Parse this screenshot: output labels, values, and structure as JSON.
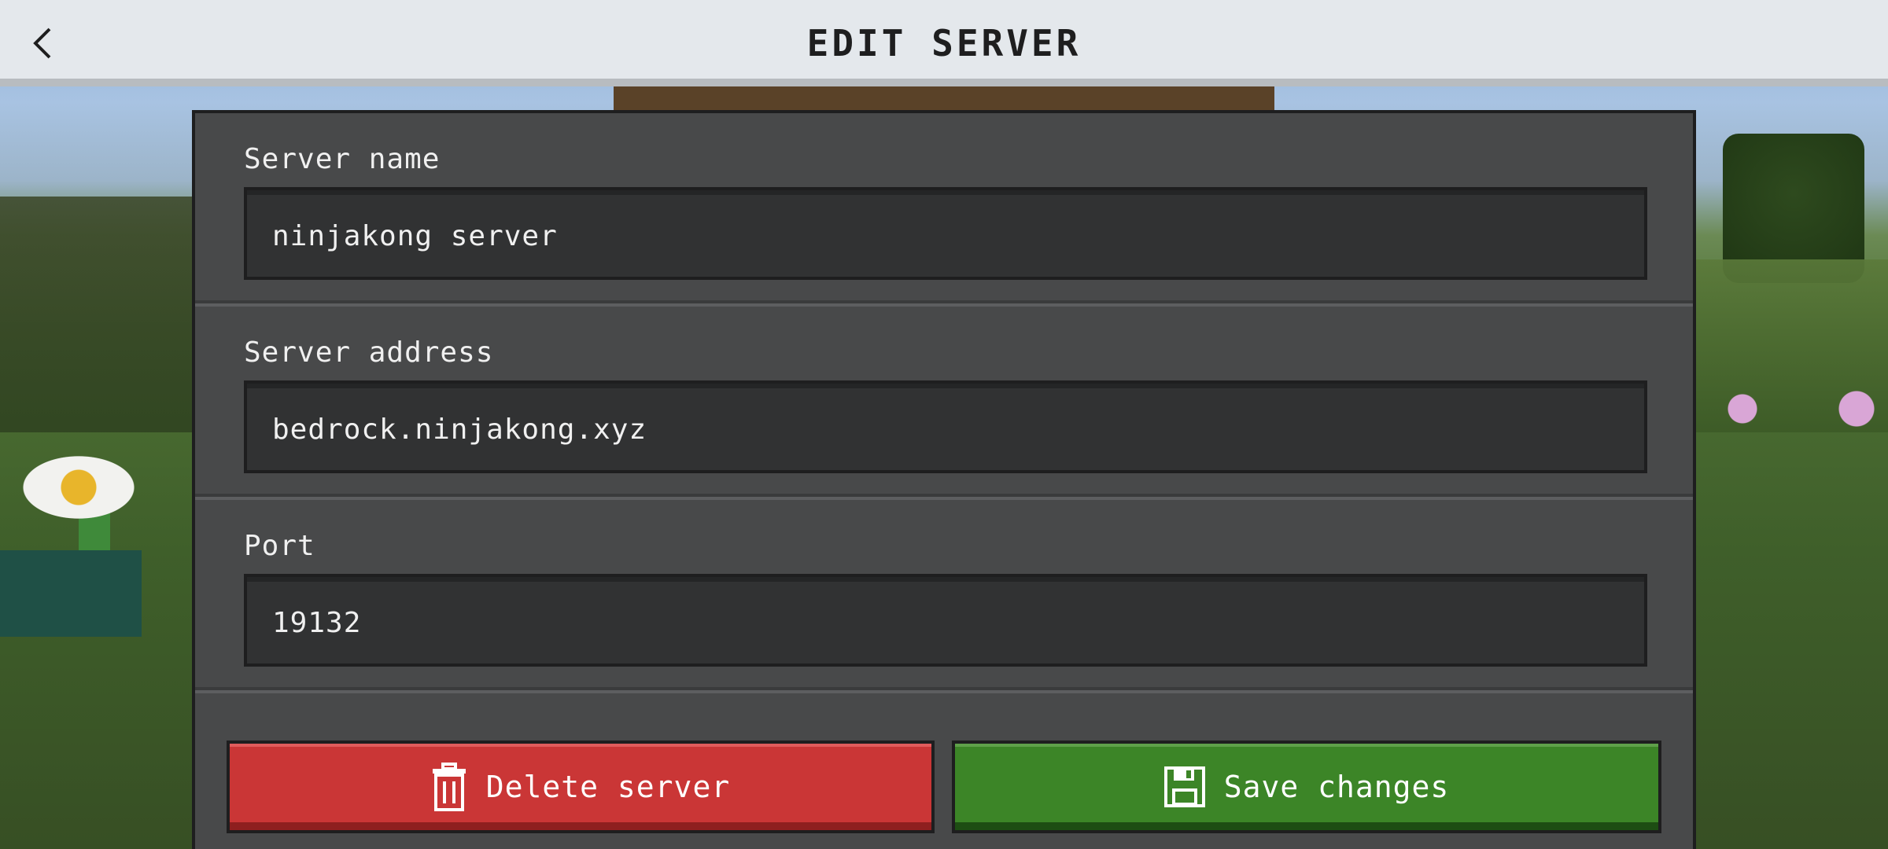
{
  "header": {
    "title": "EDIT SERVER",
    "back_icon": "chevron-left-icon"
  },
  "form": {
    "server_name": {
      "label": "Server name",
      "value": "ninjakong server"
    },
    "server_address": {
      "label": "Server address",
      "value": "bedrock.ninjakong.xyz"
    },
    "port": {
      "label": "Port",
      "value": "19132"
    }
  },
  "actions": {
    "delete_label": "Delete server",
    "delete_icon": "trash-icon",
    "save_label": "Save changes",
    "save_icon": "floppy-disk-icon"
  },
  "colors": {
    "topbar": "#e4e8ec",
    "panel": "#48494a",
    "field": "#313233",
    "delete": "#ca3636",
    "save": "#3c8527"
  }
}
